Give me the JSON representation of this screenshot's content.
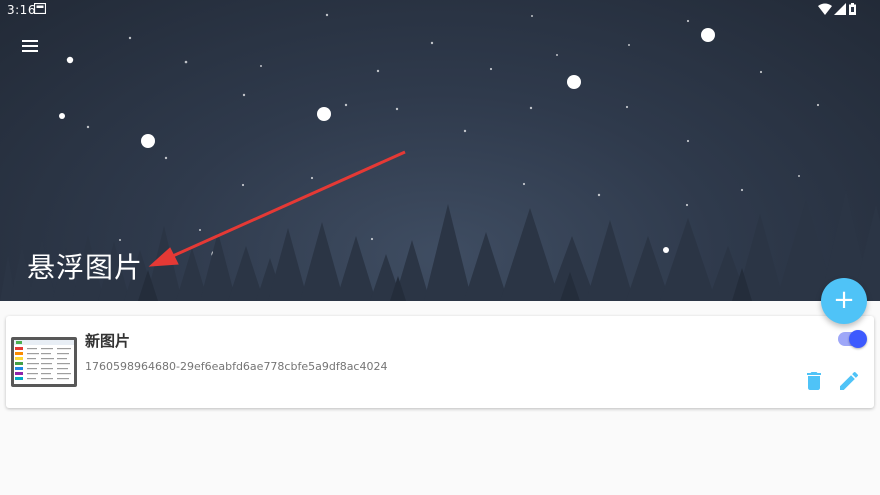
{
  "status_bar": {
    "time": "3:16",
    "icons": [
      "notification-card-icon",
      "wifi-icon",
      "signal-icon",
      "battery-icon"
    ]
  },
  "header": {
    "title": "悬浮图片",
    "menu_icon": "hamburger-menu-icon",
    "arrow_color": "#e53935"
  },
  "fab": {
    "label": "+",
    "color": "#4fc3f7"
  },
  "items": [
    {
      "title": "新图片",
      "id": "1760598964680-29ef6eabfd6ae778cbfe5a9df8ac4024",
      "enabled": true,
      "actions": [
        "delete-icon",
        "edit-icon"
      ]
    }
  ],
  "colors": {
    "accent": "#4fc3f7",
    "toggle": "#3d5afe",
    "delete": "#4fc3f7",
    "edit": "#4fc3f7"
  }
}
